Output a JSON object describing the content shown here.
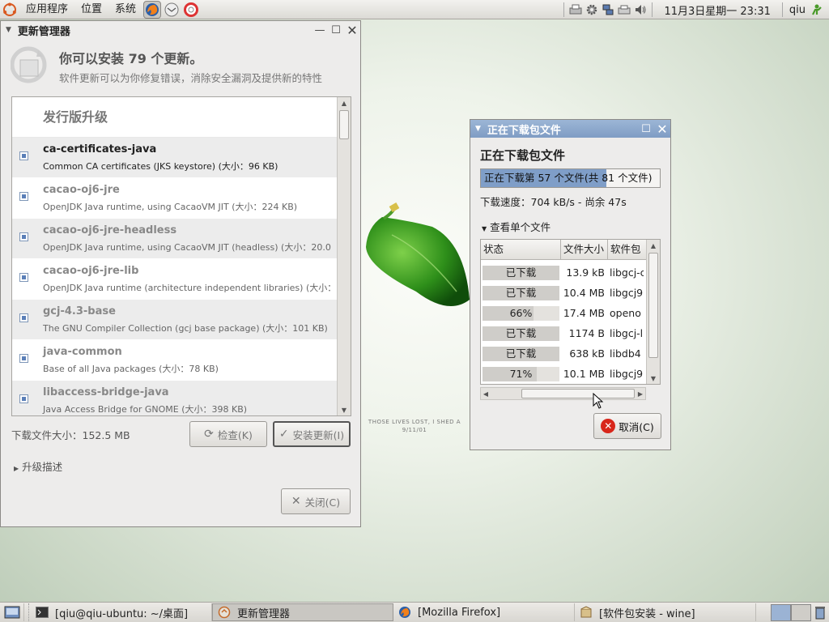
{
  "top_panel": {
    "menus": [
      "应用程序",
      "位置",
      "系统"
    ],
    "clock": "11月3日星期一 23:31",
    "user": "qiu"
  },
  "update_manager": {
    "title": "更新管理器",
    "headline": "你可以安装 79 个更新。",
    "subtitle": "软件更新可以为你修复错误，消除安全漏洞及提供新的特性",
    "section": "发行版升级",
    "packages": [
      {
        "name": "ca-certificates-java",
        "desc": "Common CA certificates (JKS keystore) (大小：96 KB)"
      },
      {
        "name": "cacao-oj6-jre",
        "desc": "OpenJDK Java runtime, using CacaoVM JIT (大小：224 KB)"
      },
      {
        "name": "cacao-oj6-jre-headless",
        "desc": "OpenJDK Java runtime, using CacaoVM JIT (headless) (大小：20.0"
      },
      {
        "name": "cacao-oj6-jre-lib",
        "desc": "OpenJDK Java runtime (architecture independent libraries) (大小："
      },
      {
        "name": "gcj-4.3-base",
        "desc": "The GNU Compiler Collection (gcj base package) (大小：101 KB)"
      },
      {
        "name": "java-common",
        "desc": "Base of all Java packages (大小：78 KB)"
      },
      {
        "name": "libaccess-bridge-java",
        "desc": "Java Access Bridge for GNOME (大小：398 KB)"
      }
    ],
    "download_size": "下载文件大小：152.5 MB",
    "check_label": "检查(K)",
    "install_label": "安装更新(I)",
    "upgrade_desc": "升级描述",
    "close_label": "关闭(C)"
  },
  "download_dialog": {
    "title": "正在下载包文件",
    "heading": "正在下载包文件",
    "progress_text": "正在下载第 57 个文件(共 81 个文件)",
    "progress_fraction": 0.7,
    "speed": "下载速度：704 kB/s - 尚余 47s",
    "expander": "查看单个文件",
    "columns": [
      "状态",
      "文件大小",
      "软件包"
    ],
    "files": [
      {
        "status": "已下载",
        "fraction": 1.0,
        "size": "13.9 kB",
        "package": "libgcj-c"
      },
      {
        "status": "已下载",
        "fraction": 1.0,
        "size": "10.4 MB",
        "package": "libgcj9"
      },
      {
        "status": "66%",
        "fraction": 0.66,
        "size": "17.4 MB",
        "package": "openo"
      },
      {
        "status": "已下载",
        "fraction": 1.0,
        "size": "1174  B",
        "package": "libgcj-l"
      },
      {
        "status": "已下载",
        "fraction": 1.0,
        "size": "638 kB",
        "package": "libdb4"
      },
      {
        "status": "71%",
        "fraction": 0.71,
        "size": "10.1 MB",
        "package": "libgcj9"
      }
    ],
    "cancel_label": "取消(C)"
  },
  "wallpaper_text": [
    "THOSE LIVES LOST, I SHED A",
    "9/11/01"
  ],
  "taskbar": [
    {
      "label": "[qiu@qiu-ubuntu: ~/桌面]",
      "active": false
    },
    {
      "label": "更新管理器",
      "active": true
    },
    {
      "label": "[Mozilla Firefox]",
      "active": false
    },
    {
      "label": "[软件包安装 - wine]",
      "active": false
    }
  ]
}
